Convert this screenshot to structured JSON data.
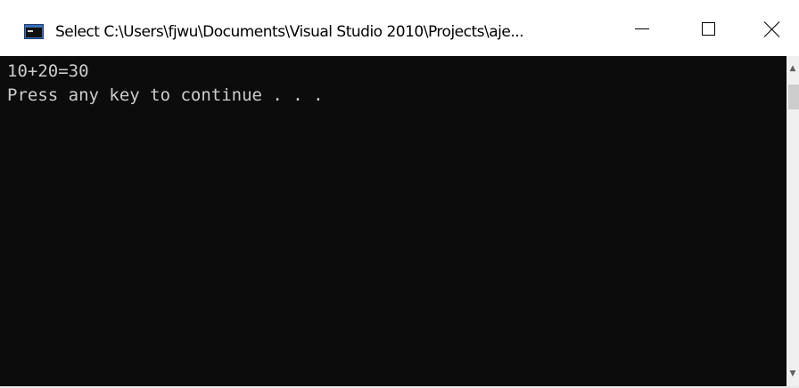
{
  "window": {
    "title": "Select C:\\Users\\fjwu\\Documents\\Visual Studio 2010\\Projects\\aje...",
    "app_icon": "console-window-icon",
    "controls": {
      "minimize_icon": "minimize-icon",
      "maximize_icon": "maximize-icon",
      "close_icon": "close-icon"
    }
  },
  "console": {
    "lines": [
      "10+20=30",
      "Press any key to continue . . ."
    ],
    "background_color": "#0c0c0c",
    "text_color": "#cccccc"
  },
  "scrollbar": {
    "up_glyph": "▲",
    "down_glyph": "▼"
  }
}
